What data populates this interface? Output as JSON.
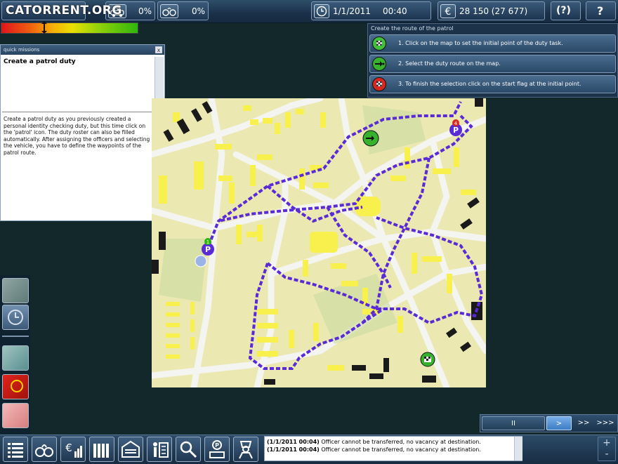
{
  "topbar": {
    "logo": "CATORRENT.ORG",
    "stat1_value": "0%",
    "stat2_value": "0%",
    "date": "1/1/2011",
    "time": "00:40",
    "money": "28 150 (27 677)",
    "help_label": "(?)",
    "question_label": "?",
    "icons": [
      "police-car-icon",
      "handcuffs-icon",
      "clock-icon",
      "euro-icon"
    ]
  },
  "gauge": {
    "label": "city-safety-level",
    "level": 0.33,
    "colors": [
      "#e0141b",
      "#f6b100",
      "#e8e100",
      "#2fb50c"
    ]
  },
  "quick_missions": {
    "title": "quick missions",
    "close": "x",
    "heading": "Create a patrol duty",
    "body": "Create a patrol duty as you previously created a personal identity checking duty, but this time click on the 'patrol' icon. The duty roster can also be filled automatically. After assigning the officers and selecting the vehicle, you have to define the waypoints of the patrol route."
  },
  "route_panel": {
    "title": "Create the route of the patrol",
    "steps": [
      {
        "text": "1. Click on the map to set the initial point of the duty task.",
        "color": "#3fc13a",
        "icon": "checkered-flag-icon"
      },
      {
        "text": "2. Select the duty route on the map.",
        "color": "#37b22c",
        "icon": "route-arrow-icon"
      },
      {
        "text": "3. To finish the selection click on the start flag at the initial point.",
        "color": "#d8281f",
        "icon": "checkered-flag-icon"
      }
    ]
  },
  "map": {
    "route_color": "#5a2ad6",
    "waypoint_start": "1",
    "waypoint_end": "4"
  },
  "messages": [
    {
      "time": "(1/1/2011 00:04)",
      "text": " Officer cannot be transferred, no vacancy at destination."
    },
    {
      "time": "(1/1/2011 00:04)",
      "text": " Officer cannot be transferred, no vacancy at destination."
    }
  ],
  "speed": {
    "pause": "II",
    "normal": ">",
    "fast": ">>",
    "fastest": ">>>"
  },
  "zoom": {
    "plus": "+",
    "minus": "-"
  }
}
